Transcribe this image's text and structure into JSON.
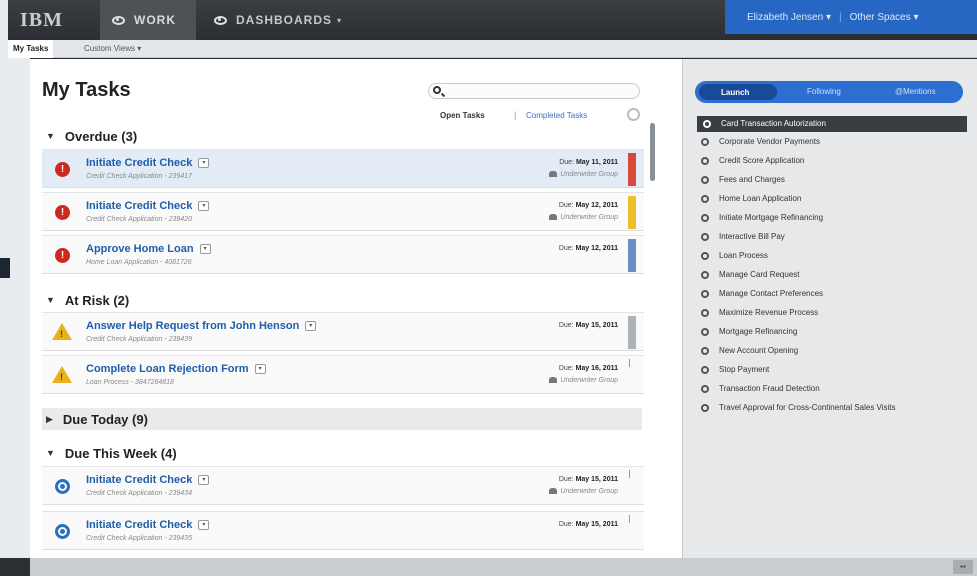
{
  "header": {
    "logo": "IBM",
    "tabs": [
      {
        "label": "WORK"
      },
      {
        "label": "DASHBOARDS"
      }
    ],
    "dashboards_caret": "▾",
    "user_name": "Elizabeth Jensen ▾",
    "user_sep": "|",
    "other_spaces": "Other Spaces ▾"
  },
  "subnav": {
    "my_tasks": "My Tasks",
    "custom_views": "Custom Views ▾"
  },
  "main": {
    "title": "My Tasks",
    "search_placeholder": "",
    "filter_open": "Open Tasks",
    "filter_sep": "|",
    "filter_completed": "Completed Tasks",
    "sections": [
      {
        "label": "Overdue (3)",
        "tri": "▼"
      },
      {
        "label": "At Risk (2)",
        "tri": "▼"
      },
      {
        "label": "Due Today (9)",
        "tri": "▶"
      },
      {
        "label": "Due This Week (4)",
        "tri": "▼"
      }
    ],
    "tasks": [
      {
        "title": "Initiate Credit Check",
        "sub": "Credit Check Application - 239417",
        "due_label": "Due:",
        "due_date": "May 11, 2011",
        "group": "Underwriter Group",
        "flag_color": "#d64a3a",
        "icon": "error"
      },
      {
        "title": "Initiate Credit Check",
        "sub": "Credit Check Application - 239420",
        "due_label": "Due:",
        "due_date": "May 12, 2011",
        "group": "Underwriter Group",
        "flag_color": "#ecc02a",
        "icon": "error"
      },
      {
        "title": "Approve Home Loan",
        "sub": "Home Loan Application - 4081726",
        "due_label": "Due:",
        "due_date": "May 12, 2011",
        "group": "",
        "flag_color": "#6a8fc2",
        "icon": "error"
      },
      {
        "title": "Answer Help Request from John Henson",
        "sub": "Credit Check Application - 239439",
        "due_label": "Due:",
        "due_date": "May 15, 2011",
        "group": "",
        "flag_color": "#aeb3b8",
        "icon": "warning"
      },
      {
        "title": "Complete Loan Rejection Form",
        "sub": "Loan Process - 3847264818",
        "due_label": "Due:",
        "due_date": "May 16, 2011",
        "group": "Underwriter Group",
        "flag_color": "",
        "icon": "warning"
      },
      {
        "title": "Initiate Credit Check",
        "sub": "Credit Check Application - 239434",
        "due_label": "Due:",
        "due_date": "May 15, 2011",
        "group": "Underwriter Group",
        "flag_color": "",
        "icon": "circle"
      },
      {
        "title": "Initiate Credit Check",
        "sub": "Credit Check Application - 239435",
        "due_label": "Due:",
        "due_date": "May 15, 2011",
        "group": "",
        "flag_color": "",
        "icon": "circle"
      }
    ]
  },
  "launch": {
    "tabs": [
      "Launch",
      "Following",
      "@Mentions"
    ],
    "items": [
      "Card Transaction Autorization",
      "Corporate Vendor Payments",
      "Credit Score Application",
      "Fees and Charges",
      "Home Loan Application",
      "Initiate Mortgage Refinancing",
      "Interactive Bill Pay",
      "Loan Process",
      "Manage Card Request",
      "Manage Contact Preferences",
      "Maximize Revenue Process",
      "Mortgage Refinancing",
      "New Account Opening",
      "Stop Payment",
      "Transaction Fraud Detection",
      "Travel Approval for Cross-Continental Sales Visits"
    ]
  },
  "colors": {
    "accent_blue": "#2667c4",
    "link_blue": "#1f5ea8",
    "error_red": "#cc2a20",
    "warning_yellow": "#e9b21c"
  }
}
